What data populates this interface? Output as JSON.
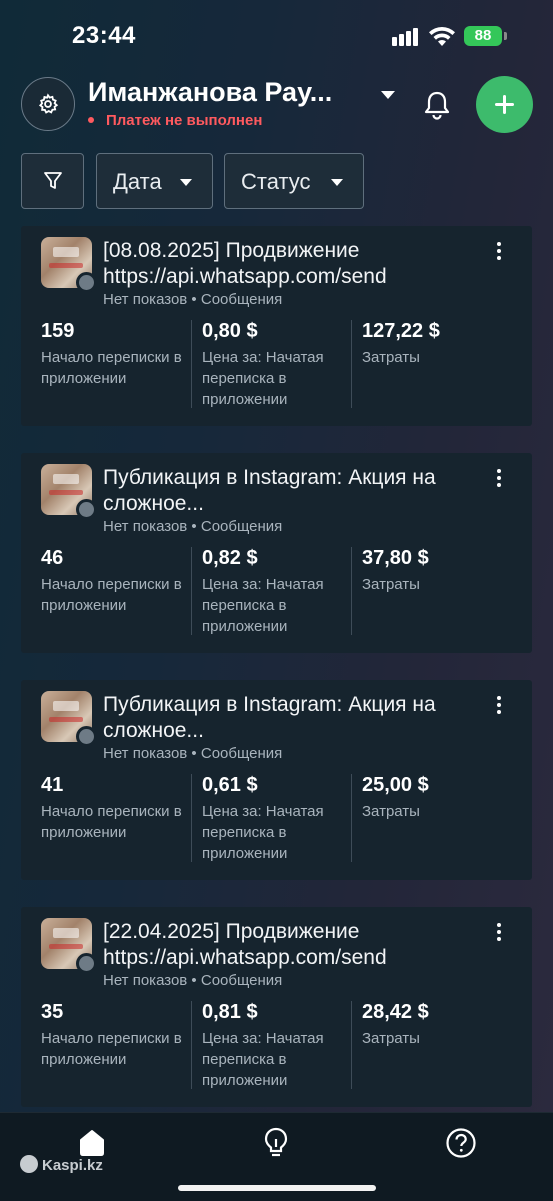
{
  "status_bar": {
    "time": "23:44",
    "battery": "88"
  },
  "header": {
    "account_name": "Иманжанова Рау...",
    "payment_status": "Платеж не выполнен"
  },
  "filters": {
    "date_label": "Дата",
    "status_label": "Статус"
  },
  "cards": [
    {
      "title": "[08.08.2025] Продвижение https://api.whatsapp.com/send",
      "delivery": "Нет показов",
      "objective": "Сообщения",
      "results": "159",
      "results_label": "Начало переписки в приложении",
      "cost_per": "0,80 $",
      "cost_per_label": "Цена за: Начатая переписка в приложении",
      "spent": "127,22 $",
      "spent_label": "Затраты"
    },
    {
      "title": "Публикация в Instagram: Акция на сложное...",
      "delivery": "Нет показов",
      "objective": "Сообщения",
      "results": "46",
      "results_label": "Начало переписки в приложении",
      "cost_per": "0,82 $",
      "cost_per_label": "Цена за: Начатая переписка в приложении",
      "spent": "37,80 $",
      "spent_label": "Затраты"
    },
    {
      "title": "Публикация в Instagram: Акция на сложное...",
      "delivery": "Нет показов",
      "objective": "Сообщения",
      "results": "41",
      "results_label": "Начало переписки в приложении",
      "cost_per": "0,61 $",
      "cost_per_label": "Цена за: Начатая переписка в приложении",
      "spent": "25,00 $",
      "spent_label": "Затраты"
    },
    {
      "title": "[22.04.2025] Продвижение https://api.whatsapp.com/send",
      "delivery": "Нет показов",
      "objective": "Сообщения",
      "results": "35",
      "results_label": "Начало переписки в приложении",
      "cost_per": "0,81 $",
      "cost_per_label": "Цена за: Начатая переписка в приложении",
      "spent": "28,42 $",
      "spent_label": "Затраты"
    }
  ],
  "bottom_nav": {
    "items": [
      {
        "icon": "home-icon"
      },
      {
        "icon": "lightbulb-icon"
      },
      {
        "icon": "help-icon"
      }
    ]
  },
  "watermark": "Kaspi.kz",
  "colors": {
    "accent_green": "#3dbb6c",
    "error_red": "#ff5a5f",
    "card_bg": "#16242e"
  }
}
